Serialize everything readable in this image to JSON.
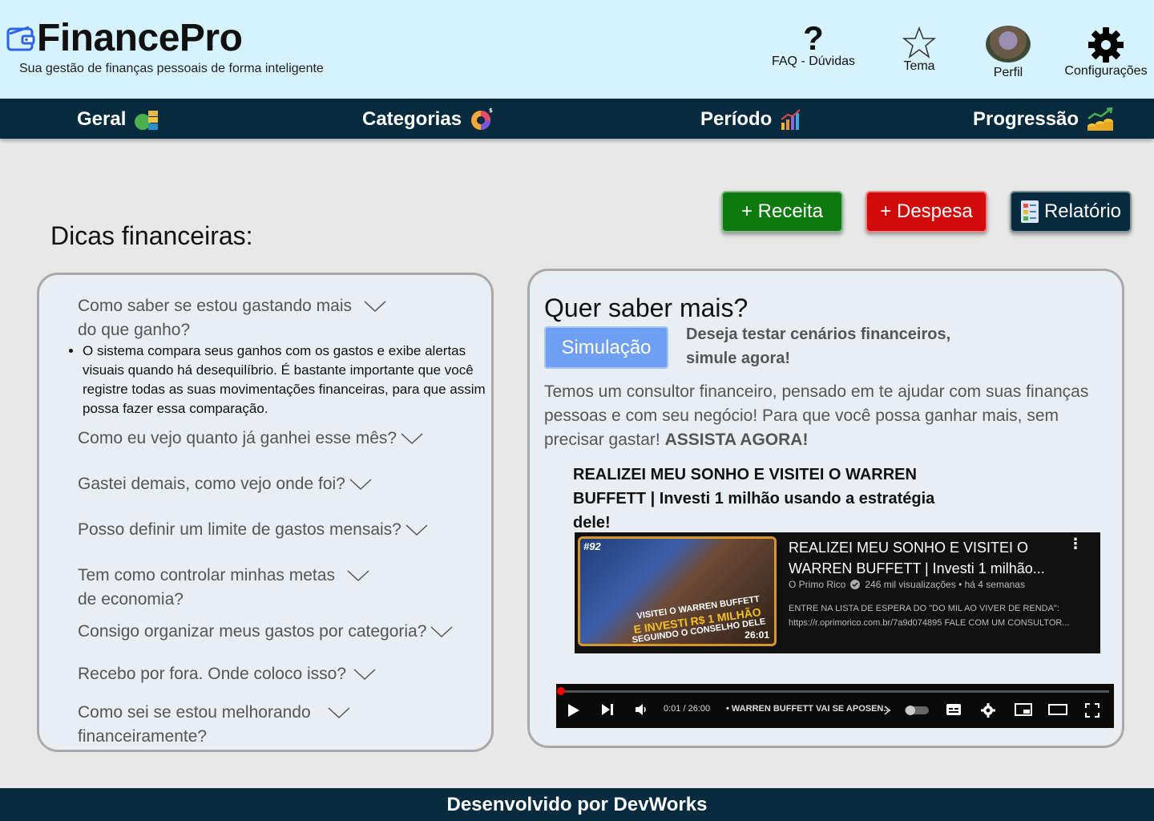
{
  "header": {
    "brand": "FinancePro",
    "tagline": "Sua gestão de finanças pessoais de forma inteligente",
    "actions": {
      "faq": "FAQ - Dúvidas",
      "tema": "Tema",
      "perfil": "Perfil",
      "config": "Configurações"
    }
  },
  "nav": {
    "geral": "Geral",
    "categorias": "Categorias",
    "periodo": "Período",
    "progressao": "Progressão"
  },
  "buttons": {
    "receita": "+ Receita",
    "despesa": "+ Despesa",
    "relatorio": "Relatório"
  },
  "section_title": "Dicas financeiras:",
  "faq": {
    "questions": [
      "Como saber se estou gastando mais do que ganho?",
      "Como eu vejo quanto já ganhei esse mês?",
      "Gastei demais, como vejo onde foi?",
      "Posso definir um limite de gastos mensais?",
      "Tem como controlar minhas metas de economia?",
      "Consigo organizar meus gastos por categoria?",
      "Recebo por fora. Onde coloco isso?",
      "Como sei se estou melhorando financeiramente?"
    ],
    "answer": "O sistema compara seus ganhos com os gastos e exibe alertas visuais quando há desequilíbrio. É bastante importante que você registre todas as suas movimentações financeiras, para que assim possa fazer essa comparação."
  },
  "learn_more": {
    "title": "Quer saber mais?",
    "sim_button": "Simulação",
    "sim_text": "Deseja testar cenários financeiros, simule agora!",
    "desc": "Temos um consultor financeiro, pensado em te ajudar com suas finanças pessoas e com seu negócio! Para que você possa ganhar mais, sem precisar gastar!",
    "desc_strong": "ASSISTA AGORA!",
    "video_title": "REALIZEI MEU SONHO E VISITEI O WARREN BUFFETT | Investi 1 milhão usando a estratégia dele!"
  },
  "video": {
    "thumb_ep": "#92",
    "thumb_line1": "VISITEI O WARREN BUFFETT",
    "thumb_line2": "E INVESTI R$ 1 MILHÃO",
    "thumb_line3": "SEGUINDO O CONSELHO DELE",
    "duration": "26:01",
    "title": "REALIZEI MEU SONHO E VISITEI O WARREN BUFFETT | Investi 1 milhão...",
    "channel": "O Primo Rico",
    "views": "246 mil visualizações • há 4 semanas",
    "desc_line1": "ENTRE NA LISTA DE ESPERA DO \"DO MIL AO VIVER DE RENDA\":",
    "desc_line2": "https://r.oprimorico.com.br/7a9d074895 FALE COM UM CONSULTOR...",
    "time": "0:01 / 26:00",
    "chapter": "• WARREN BUFFETT VAI SE APOSEN...",
    "progress": 0.0
  },
  "footer": "Desenvolvido por DevWorks",
  "colors": {
    "header_bg": "#d6f2fc",
    "nav_bg": "#062a3e",
    "receita": "#0d7a10",
    "despesa": "#d20a0a",
    "simulacao": "#6f9ff3"
  }
}
